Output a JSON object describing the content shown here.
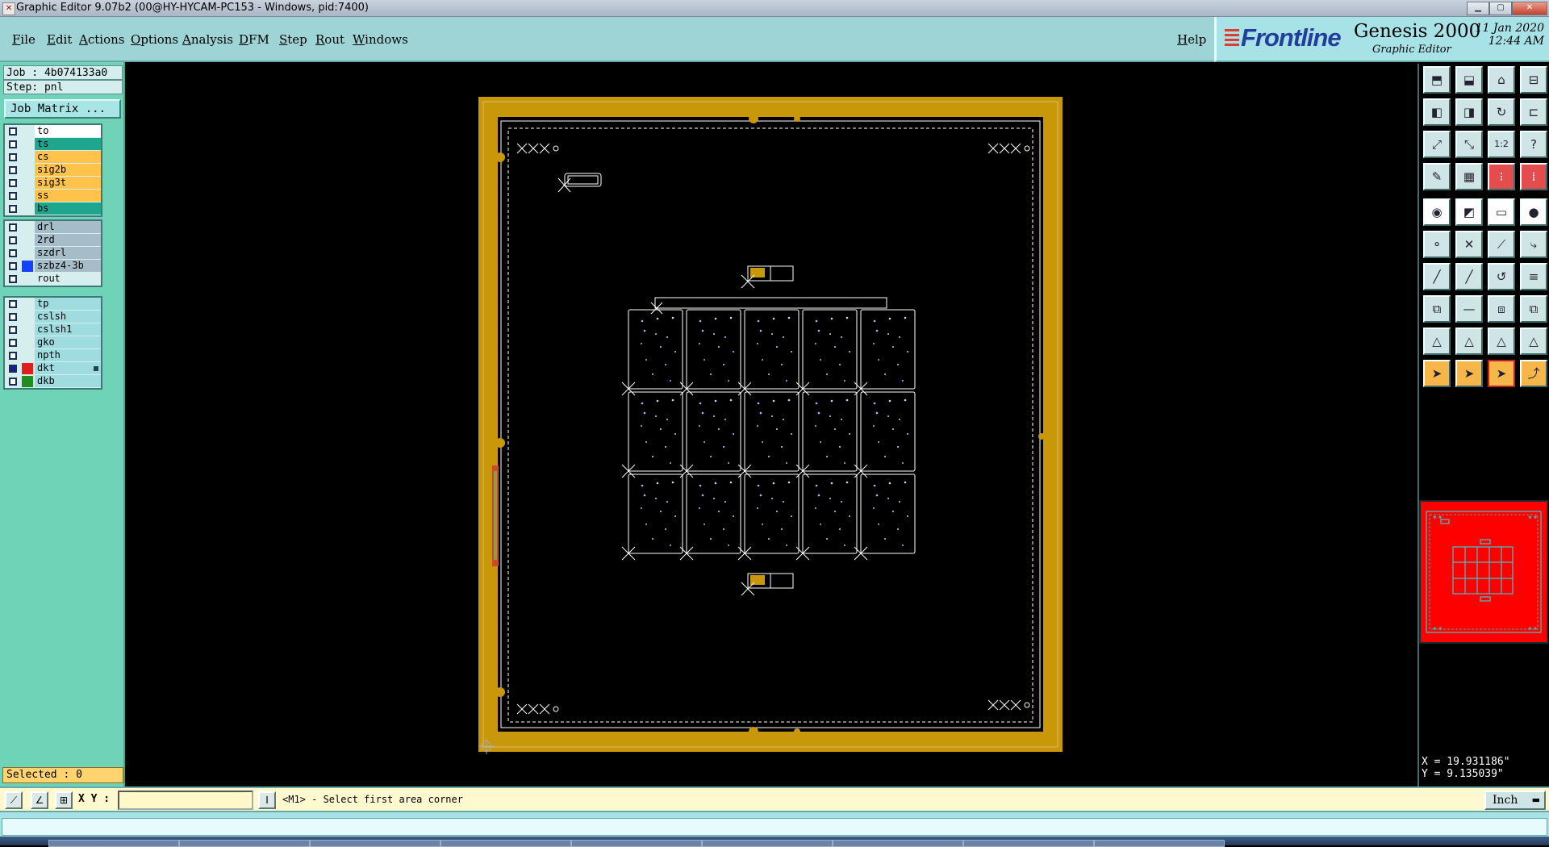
{
  "window": {
    "title": "Graphic Editor 9.07b2 (00@HY-HYCAM-PC153 - Windows, pid:7400)"
  },
  "menu": {
    "items": [
      "File",
      "Edit",
      "Actions",
      "Options",
      "Analysis",
      "DFM",
      "Step",
      "Rout",
      "Windows"
    ],
    "help": "Help"
  },
  "brand": {
    "logo": "Frontline",
    "product": "Genesis 2000",
    "subtitle": "Graphic Editor",
    "date": "11 Jan 2020",
    "time": "12:44 AM"
  },
  "job": {
    "job_label": "Job : 4b074133a0",
    "step_label": "Step: pnl",
    "matrix_button": "Job Matrix ..."
  },
  "layers": {
    "groups": [
      {
        "items": [
          {
            "name": "to",
            "bg": "#ffffff",
            "swatch": null,
            "checked": false
          },
          {
            "name": "ts",
            "bg": "#1fa68e",
            "swatch": null,
            "checked": false
          },
          {
            "name": "cs",
            "bg": "#ffc24a",
            "swatch": null,
            "checked": false
          },
          {
            "name": "sig2b",
            "bg": "#ffc24a",
            "swatch": null,
            "checked": false
          },
          {
            "name": "sig3t",
            "bg": "#ffc24a",
            "swatch": null,
            "checked": false
          },
          {
            "name": "ss",
            "bg": "#ffc24a",
            "swatch": null,
            "checked": false
          },
          {
            "name": "bs",
            "bg": "#1fa68e",
            "swatch": null,
            "checked": false
          }
        ]
      },
      {
        "items": [
          {
            "name": "drl",
            "bg": "#a6bcc9",
            "swatch": null,
            "checked": false
          },
          {
            "name": "2rd",
            "bg": "#a6bcc9",
            "swatch": null,
            "checked": false
          },
          {
            "name": "szdrl",
            "bg": "#a6bcc9",
            "swatch": null,
            "checked": false
          },
          {
            "name": "szbz4-3b",
            "bg": "#a6bcc9",
            "swatch": "#1540ff",
            "checked": false
          },
          {
            "name": "rout",
            "bg": "#d6eeee",
            "swatch": null,
            "checked": false
          }
        ]
      },
      {
        "items": [
          {
            "name": "tp",
            "bg": "#9fdce0",
            "swatch": null,
            "checked": false
          },
          {
            "name": "cslsh",
            "bg": "#9fdce0",
            "swatch": null,
            "checked": false
          },
          {
            "name": "cslsh1",
            "bg": "#9fdce0",
            "swatch": null,
            "checked": false
          },
          {
            "name": "gko",
            "bg": "#9fdce0",
            "swatch": null,
            "checked": false
          },
          {
            "name": "npth",
            "bg": "#9fdce0",
            "swatch": null,
            "checked": false
          },
          {
            "name": "dkt",
            "bg": "#9fdce0",
            "swatch": "#e21d1d",
            "checked": true,
            "mark": true
          },
          {
            "name": "dkb",
            "bg": "#9fdce0",
            "swatch": "#1e8f1e",
            "checked": false
          }
        ]
      }
    ]
  },
  "status": {
    "selected": "Selected : 0"
  },
  "coords": {
    "x": "X = 19.931186\"",
    "y": "Y =  9.135039\""
  },
  "command": {
    "xy_label": "X Y :",
    "xy_value": "",
    "cursor_button": "I",
    "prompt": "<M1> - Select first area corner",
    "units": "Inch"
  },
  "tools": [
    "goto-home-icon",
    "zoom-back-icon",
    "home-icon",
    "panel-icon",
    "pan-left-icon",
    "pan-right-icon",
    "redraw-icon",
    "snap-icon",
    "fit-screen-icon",
    "fit-step-icon",
    "scale-1-2-icon",
    "query-icon",
    "mouse-icon",
    "grid-icon",
    "layers-a-icon",
    "layers-b-icon",
    "drill-icon",
    "drawline-icon",
    "ruler-icon",
    "pad-icon",
    "node-icon",
    "cross-icon",
    "connect-icon",
    "link-icon",
    "line-red-icon",
    "line-blue-icon",
    "arc-icon",
    "text-icon",
    "move-icon",
    "minus-icon",
    "measure-icon",
    "copy-icon",
    "tri-a-icon",
    "tri-b-icon",
    "tri-c-icon",
    "tri-d-icon",
    "select-arrow-icon",
    "select-box-icon",
    "select-area-icon",
    "route-select-icon"
  ],
  "colors": {
    "accent": "#9fd4d6",
    "panel_bg": "#6fd3b8",
    "copper": "#c8980a",
    "overview_bg": "#ff0000"
  }
}
